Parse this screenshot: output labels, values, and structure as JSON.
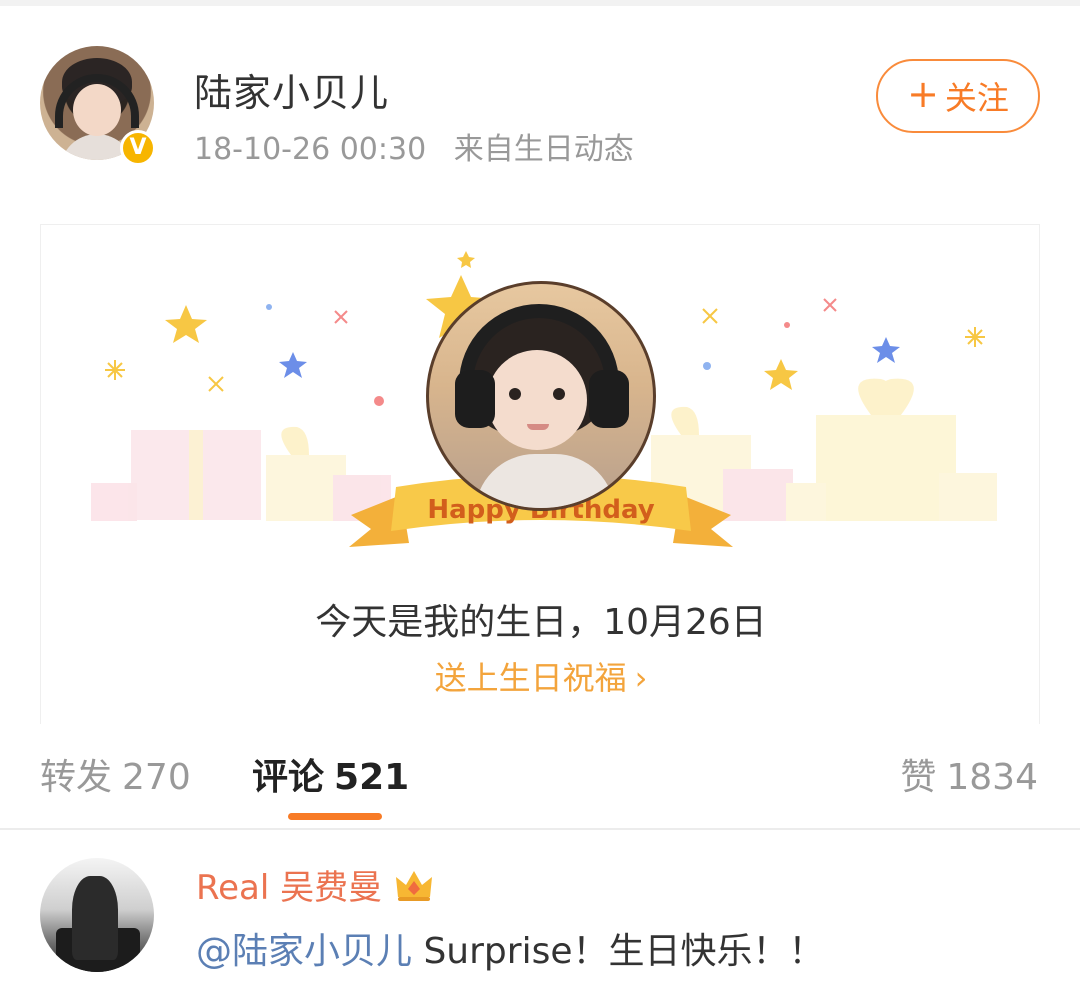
{
  "post": {
    "author": "陆家小贝儿",
    "verified_badge": "V",
    "timestamp": "18-10-26 00:30",
    "source": "来自生日动态",
    "follow_button": {
      "plus": "+",
      "label": "关注"
    }
  },
  "birthday_card": {
    "banner": "Happy Birthday",
    "message": "今天是我的生日，10月26日",
    "link": "送上生日祝福",
    "link_chevron": "›"
  },
  "tabs": {
    "repost": {
      "label": "转发",
      "count": "270"
    },
    "comments": {
      "label": "评论",
      "count": "521"
    },
    "likes": {
      "label": "赞",
      "count": "1834"
    }
  },
  "comment": {
    "author": "Real 吴费曼",
    "mention": "@陆家小贝儿",
    "text": " Surprise！生日快乐！！"
  },
  "colors": {
    "accent": "#f87b26",
    "link_gold": "#f3a43c",
    "mention_blue": "#5b7fb4",
    "comment_author": "#eb7350"
  },
  "icons": {
    "verified": "verified-badge-icon",
    "crown": "crown-icon",
    "chevron": "chevron-right-icon"
  }
}
